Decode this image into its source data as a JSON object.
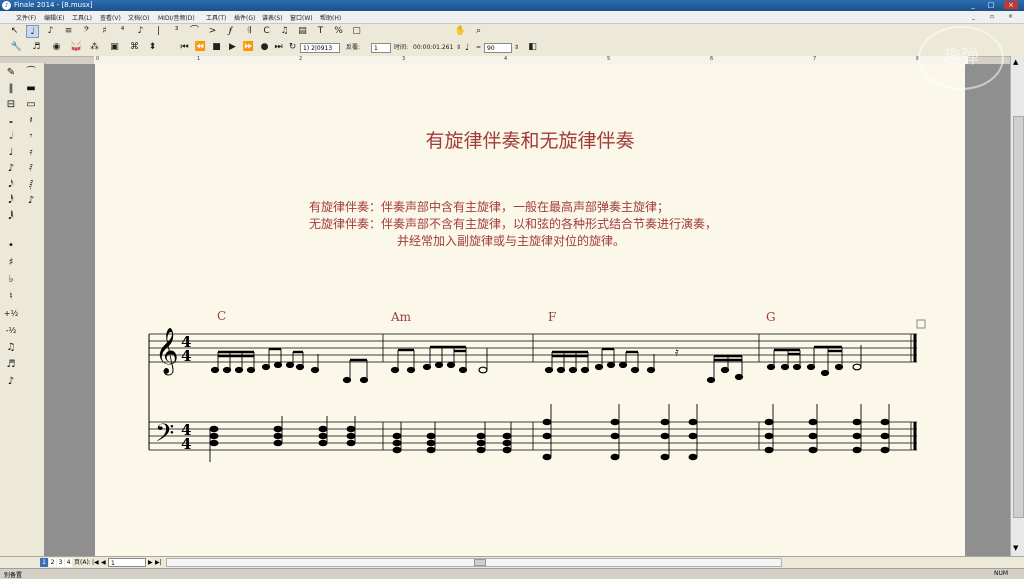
{
  "window": {
    "title": "Finale 2014 - [8.musx]",
    "app_icon": "finale-logo-icon",
    "buttons": [
      "_",
      "□",
      "×"
    ]
  },
  "menu": [
    "文件(F)",
    "编辑(E)",
    "工具(L)",
    "查看(V)",
    "文档(O)",
    "MIDI/音频(D)",
    "工具(T)",
    "插件(G)",
    "谱表(S)",
    "窗口(W)",
    "帮助(H)"
  ],
  "playback": {
    "measure": "1) 2|0913",
    "repeat_label": "反覆:",
    "repeat_value": "1",
    "time_label": "时间:",
    "time_value": "00:00:01.261",
    "tempo_note": "♩",
    "tempo_eq": "=",
    "tempo_value": "90"
  },
  "ruler_ticks": [
    "0",
    "1",
    "2",
    "3",
    "4",
    "5",
    "6",
    "7",
    "8"
  ],
  "score": {
    "title": "有旋律伴奏和无旋律伴奏",
    "line1": "有旋律伴奏：伴奏声部中含有主旋律，一般在最高声部弹奏主旋律；",
    "line2": "无旋律伴奏：伴奏声部不含有主旋律，以和弦的各种形式结合节奏进行演奏，",
    "line3": "并经常加入副旋律或与主旋律对位的旋律。",
    "chords": [
      "C",
      "Am",
      "F",
      "G"
    ],
    "time_sig_top": "4",
    "time_sig_bottom": "4"
  },
  "bottom_bar": {
    "pages": [
      "1",
      "2",
      "3",
      "4"
    ],
    "page_label": "页(A):",
    "page_value": "1"
  },
  "status": {
    "left": "别备置",
    "right": "NUM"
  },
  "watermark": "趣弹",
  "colors": {
    "accent_red": "#a23b3b",
    "paper": "#fbf8e9",
    "titlebar": "#1c4f8a"
  }
}
